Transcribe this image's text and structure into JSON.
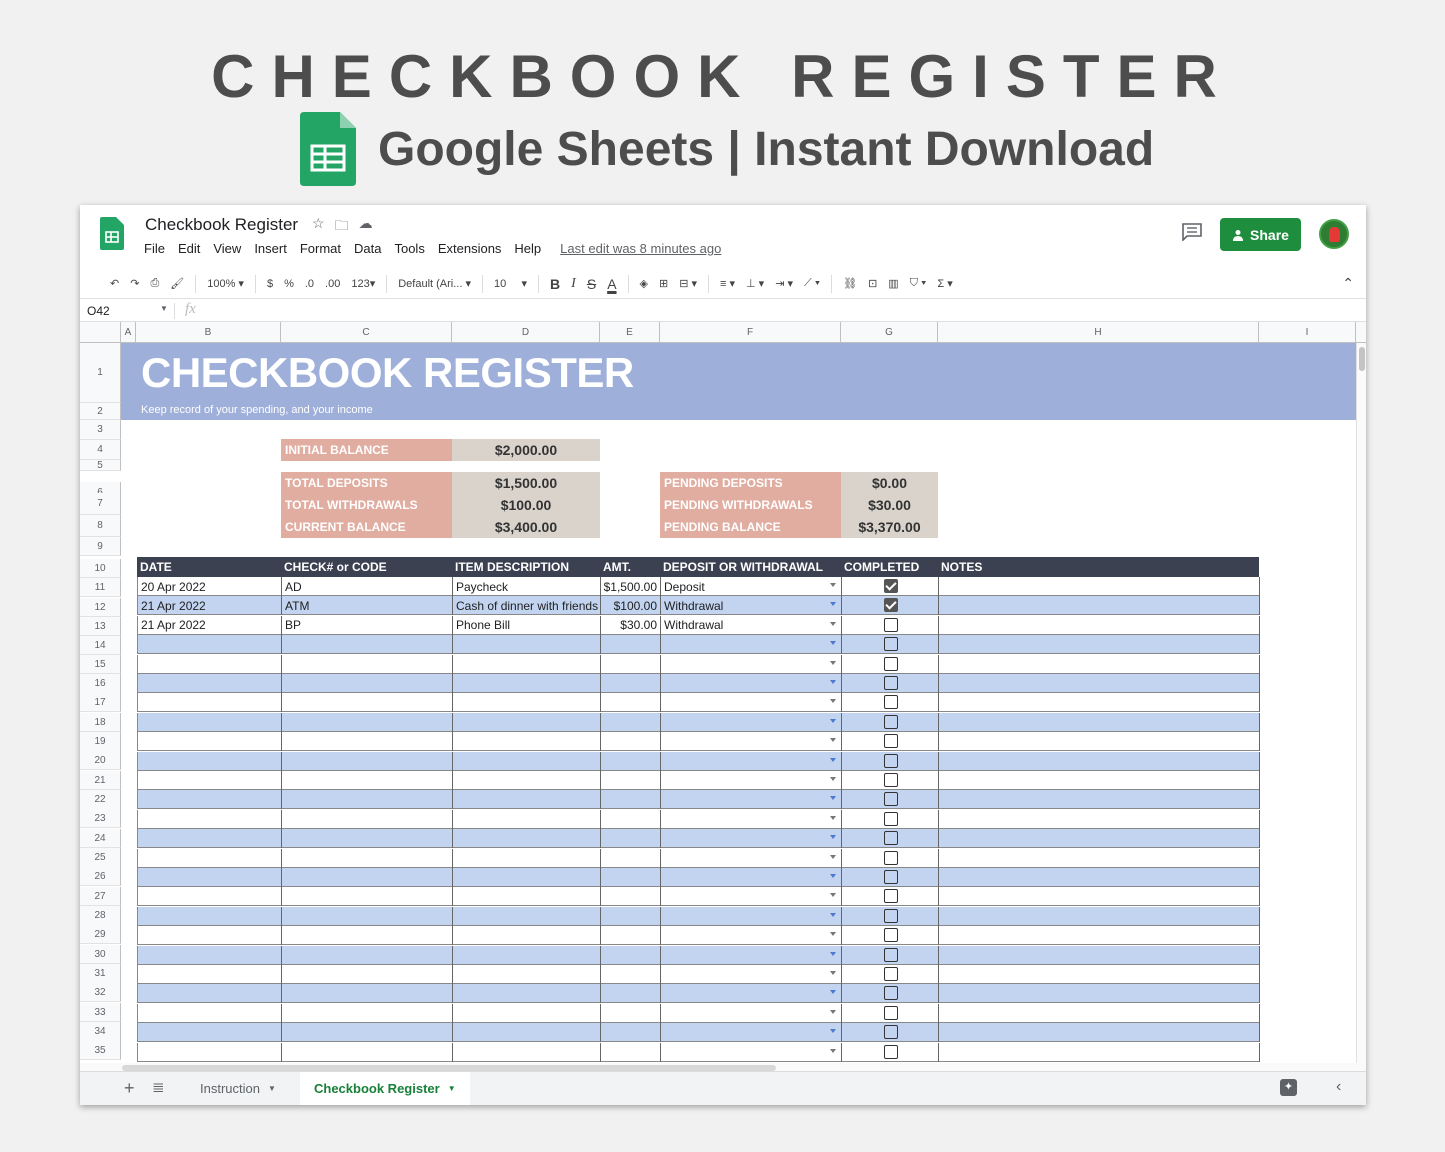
{
  "hero": {
    "title": "CHECKBOOK REGISTER",
    "subtitle": "Google Sheets | Instant Download"
  },
  "doc": {
    "title": "Checkbook Register",
    "last_edit": "Last edit was 8 minutes ago",
    "menus": [
      "File",
      "Edit",
      "View",
      "Insert",
      "Format",
      "Data",
      "Tools",
      "Extensions",
      "Help"
    ],
    "share_label": "Share"
  },
  "toolbar": {
    "zoom": "100%",
    "currency": "$",
    "percent": "%",
    "dec_less": ".0",
    "dec_more": ".00",
    "number_format": "123",
    "font": "Default (Ari...",
    "font_size": "10",
    "bold": "B",
    "italic": "I",
    "strike": "S",
    "text_color": "A",
    "sigma": "Σ"
  },
  "formula_bar": {
    "name_box": "O42",
    "fx": "fx"
  },
  "columns": [
    "A",
    "B",
    "C",
    "D",
    "E",
    "F",
    "G",
    "H",
    "I"
  ],
  "rows": [
    "1",
    "2",
    "3",
    "4",
    "5",
    "6",
    "7",
    "8",
    "9",
    "10",
    "11",
    "12",
    "13",
    "14",
    "15",
    "16",
    "17",
    "18",
    "19",
    "20",
    "21",
    "22",
    "23",
    "24",
    "25",
    "26",
    "27",
    "28",
    "29",
    "30",
    "31",
    "32",
    "33",
    "34",
    "35"
  ],
  "sheet": {
    "title": "CHECKBOOK REGISTER",
    "subtitle": "Keep record of your spending, and your income",
    "initial_balance": {
      "label": "INITIAL BALANCE",
      "value": "$2,000.00"
    },
    "totals": [
      {
        "label": "TOTAL DEPOSITS",
        "value": "$1,500.00"
      },
      {
        "label": "TOTAL WITHDRAWALS",
        "value": "$100.00"
      },
      {
        "label": "CURRENT BALANCE",
        "value": "$3,400.00"
      }
    ],
    "pending": [
      {
        "label": "PENDING DEPOSITS",
        "value": "$0.00"
      },
      {
        "label": "PENDING WITHDRAWALS",
        "value": "$30.00"
      },
      {
        "label": "PENDING BALANCE",
        "value": "$3,370.00"
      }
    ],
    "table_headers": [
      "DATE",
      "CHECK# or CODE",
      "ITEM DESCRIPTION",
      "AMT.",
      "DEPOSIT OR WITHDRAWAL",
      "COMPLETED",
      "NOTES"
    ],
    "entries": [
      {
        "date": "20 Apr 2022",
        "code": "AD",
        "description": "Paycheck",
        "amount": "$1,500.00",
        "type": "Deposit",
        "completed": true,
        "notes": ""
      },
      {
        "date": "21 Apr 2022",
        "code": "ATM",
        "description": "Cash of dinner with friends",
        "amount": "$100.00",
        "type": "Withdrawal",
        "completed": true,
        "notes": ""
      },
      {
        "date": "21 Apr 2022",
        "code": "BP",
        "description": "Phone Bill",
        "amount": "$30.00",
        "type": "Withdrawal",
        "completed": false,
        "notes": ""
      }
    ],
    "empty_rows": 22
  },
  "tabs": [
    {
      "label": "Instruction",
      "active": false
    },
    {
      "label": "Checkbook Register",
      "active": true
    }
  ],
  "colors": {
    "banner": "#9eafda",
    "summary_label": "#e0ada0",
    "summary_value": "#d9d3cc",
    "table_header": "#3c4152",
    "row_alt": "#c2d4ef",
    "share": "#1e8e3e"
  }
}
